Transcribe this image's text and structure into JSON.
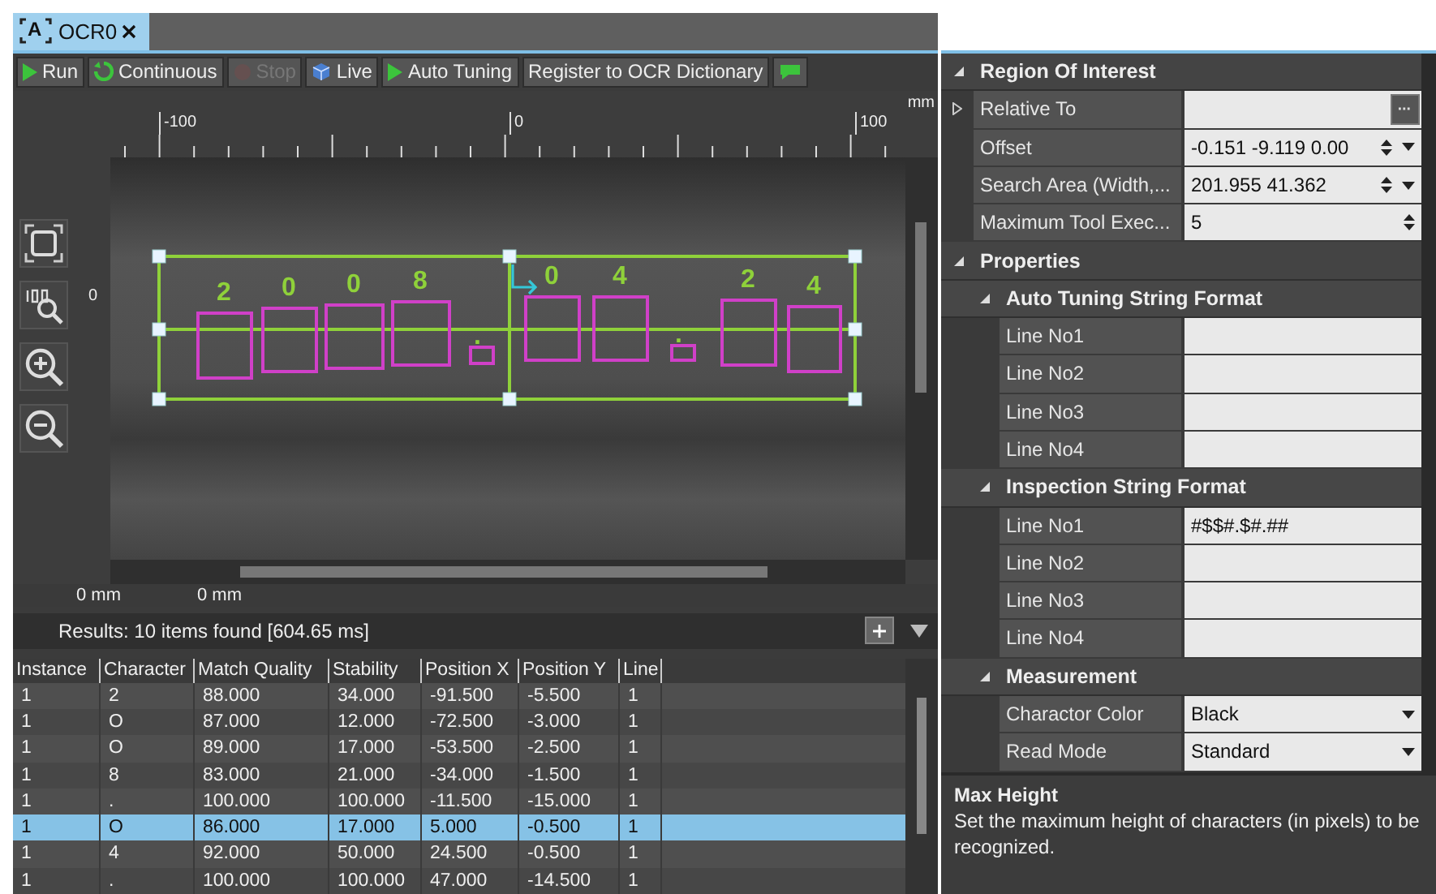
{
  "tab": {
    "icon_letter": "A",
    "label": "OCR0",
    "selected": true
  },
  "toolbar": [
    {
      "kind": "run",
      "label": "Run",
      "disabled": false
    },
    {
      "kind": "continuous",
      "label": "Continuous",
      "disabled": false
    },
    {
      "kind": "stop",
      "label": "Stop",
      "disabled": true
    },
    {
      "kind": "live",
      "label": "Live",
      "disabled": false
    },
    {
      "kind": "auto-tuning",
      "label": "Auto Tuning",
      "disabled": false
    },
    {
      "kind": "text",
      "label": "Register to OCR Dictionary",
      "disabled": false
    },
    {
      "kind": "comment",
      "disabled": false
    }
  ],
  "viewer": {
    "ruler_unit": "mm",
    "ruler_x_labels": [
      "-100",
      "0",
      "100"
    ],
    "ruler_y_labels": [
      "0"
    ],
    "detected_characters": [
      "2",
      "0",
      "0",
      "8",
      ".",
      "0",
      "4",
      ".",
      "2",
      "4"
    ],
    "cursor_readouts": [
      "0 mm",
      "0 mm"
    ]
  },
  "results": {
    "summary": "Results: 10 items found [604.65 ms]",
    "columns": [
      "Instance",
      "Character",
      "Match Quality",
      "Stability",
      "Position X",
      "Position Y",
      "Line"
    ],
    "rows": [
      {
        "cells": [
          "1",
          "2",
          "88.000",
          "34.000",
          "-91.500",
          "-5.500",
          "1"
        ],
        "selected": false
      },
      {
        "cells": [
          "1",
          "O",
          "87.000",
          "12.000",
          "-72.500",
          "-3.000",
          "1"
        ],
        "selected": false
      },
      {
        "cells": [
          "1",
          "O",
          "89.000",
          "17.000",
          "-53.500",
          "-2.500",
          "1"
        ],
        "selected": false
      },
      {
        "cells": [
          "1",
          "8",
          "83.000",
          "21.000",
          "-34.000",
          "-1.500",
          "1"
        ],
        "selected": false
      },
      {
        "cells": [
          "1",
          ".",
          "100.000",
          "100.000",
          "-11.500",
          "-15.000",
          "1"
        ],
        "selected": false
      },
      {
        "cells": [
          "1",
          "O",
          "86.000",
          "17.000",
          "5.000",
          "-0.500",
          "1"
        ],
        "selected": true
      },
      {
        "cells": [
          "1",
          "4",
          "92.000",
          "50.000",
          "24.500",
          "-0.500",
          "1"
        ],
        "selected": false
      },
      {
        "cells": [
          "1",
          ".",
          "100.000",
          "100.000",
          "47.000",
          "-14.500",
          "1"
        ],
        "selected": false
      }
    ]
  },
  "properties": {
    "sections": [
      {
        "title": "Region Of Interest",
        "expanded": true,
        "rows": [
          {
            "label": "Relative To",
            "kind": "browse",
            "expanded": false
          },
          {
            "label": "Offset",
            "kind": "spin-dropdown",
            "value": "-0.151 -9.119 0.00"
          },
          {
            "label": "Search Area (Width,...",
            "kind": "spin-dropdown",
            "value": "201.955 41.362"
          },
          {
            "label": "Maximum Tool Exec...",
            "kind": "spin",
            "value": "5"
          }
        ]
      },
      {
        "title": "Properties",
        "expanded": true,
        "children": [
          {
            "title": "Auto Tuning String Format",
            "expanded": true,
            "rows": [
              {
                "label": "Line No1",
                "kind": "text"
              },
              {
                "label": "Line No2",
                "kind": "text"
              },
              {
                "label": "Line No3",
                "kind": "text"
              },
              {
                "label": "Line No4",
                "kind": "text"
              }
            ]
          },
          {
            "title": "Inspection String Format",
            "expanded": true,
            "rows": [
              {
                "label": "Line No1",
                "kind": "text",
                "value": "#$$#.$#.##"
              },
              {
                "label": "Line No2",
                "kind": "text"
              },
              {
                "label": "Line No3",
                "kind": "text"
              },
              {
                "label": "Line No4",
                "kind": "text"
              }
            ]
          },
          {
            "title": "Measurement",
            "expanded": true,
            "rows": [
              {
                "label": "Charactor Color",
                "kind": "dropdown",
                "value": "Black"
              },
              {
                "label": "Read Mode",
                "kind": "dropdown",
                "value": "Standard"
              }
            ]
          }
        ]
      }
    ],
    "help": {
      "title": "Max Height",
      "text": "Set the maximum height of characters (in pixels) to be recognized."
    }
  }
}
